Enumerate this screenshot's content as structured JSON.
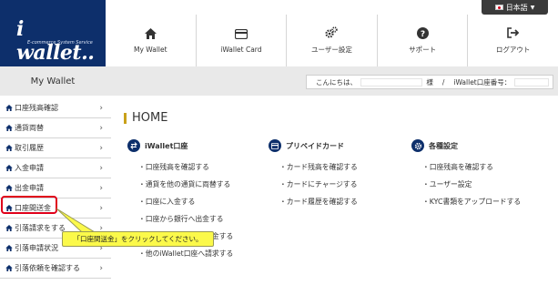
{
  "header": {
    "logo": "wallet..",
    "logo_initial": "i",
    "logo_sub": "E-commerce System Service",
    "language": "日本語",
    "nav": [
      {
        "label": "My Wallet",
        "icon": "home-icon"
      },
      {
        "label": "iWallet Card",
        "icon": "card-icon"
      },
      {
        "label": "ユーザー設定",
        "icon": "gears-icon"
      },
      {
        "label": "サポート",
        "icon": "question-icon"
      },
      {
        "label": "ログアウト",
        "icon": "logout-icon"
      }
    ]
  },
  "band": {
    "side_title": "My Wallet",
    "greeting_prefix": "こんにちは、",
    "greeting_suffix": "様",
    "separator": "/",
    "account_label": "iWallet口座番号："
  },
  "sidebar": {
    "items": [
      {
        "label": "口座残高確認"
      },
      {
        "label": "通貨両替"
      },
      {
        "label": "取引履歴"
      },
      {
        "label": "入金申請"
      },
      {
        "label": "出金申請"
      },
      {
        "label": "口座間送金"
      },
      {
        "label": "引落請求をする"
      },
      {
        "label": "引落申請状況"
      },
      {
        "label": "引落依頼を確認する"
      }
    ]
  },
  "main": {
    "title": "HOME",
    "columns": [
      {
        "heading": "iWallet口座",
        "icon": "exchange-icon",
        "links": [
          "口座残高を確認する",
          "通貨を他の通貨に両替する",
          "口座に入金する",
          "口座から銀行へ出金する",
          "他のiWallet口座へ送金する",
          "他のiWallet口座へ請求する"
        ]
      },
      {
        "heading": "プリペイドカード",
        "icon": "card-icon",
        "links": [
          "カード残高を確認する",
          "カードにチャージする",
          "カード履歴を確認する"
        ]
      },
      {
        "heading": "各種設定",
        "icon": "gear-icon",
        "links": [
          "口座残高を確認する",
          "ユーザー設定",
          "KYC書類をアップロードする"
        ]
      }
    ]
  },
  "callout": {
    "text": "「口座間送金」をクリックしてください。"
  },
  "colors": {
    "navy": "#0d2f6b",
    "highlight": "#e0001a",
    "callout": "#fbf94a",
    "accent": "#c9a11a"
  }
}
